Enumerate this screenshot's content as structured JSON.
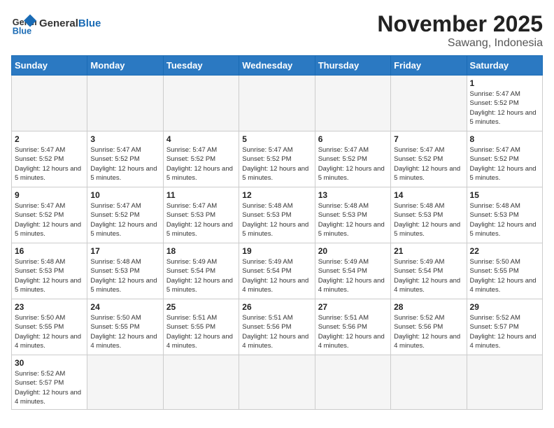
{
  "header": {
    "logo_general": "General",
    "logo_blue": "Blue",
    "month_title": "November 2025",
    "location": "Sawang, Indonesia"
  },
  "days_of_week": [
    "Sunday",
    "Monday",
    "Tuesday",
    "Wednesday",
    "Thursday",
    "Friday",
    "Saturday"
  ],
  "weeks": [
    [
      {
        "day": "",
        "info": ""
      },
      {
        "day": "",
        "info": ""
      },
      {
        "day": "",
        "info": ""
      },
      {
        "day": "",
        "info": ""
      },
      {
        "day": "",
        "info": ""
      },
      {
        "day": "",
        "info": ""
      },
      {
        "day": "1",
        "info": "Sunrise: 5:47 AM\nSunset: 5:52 PM\nDaylight: 12 hours\nand 5 minutes."
      }
    ],
    [
      {
        "day": "2",
        "info": "Sunrise: 5:47 AM\nSunset: 5:52 PM\nDaylight: 12 hours\nand 5 minutes."
      },
      {
        "day": "3",
        "info": "Sunrise: 5:47 AM\nSunset: 5:52 PM\nDaylight: 12 hours\nand 5 minutes."
      },
      {
        "day": "4",
        "info": "Sunrise: 5:47 AM\nSunset: 5:52 PM\nDaylight: 12 hours\nand 5 minutes."
      },
      {
        "day": "5",
        "info": "Sunrise: 5:47 AM\nSunset: 5:52 PM\nDaylight: 12 hours\nand 5 minutes."
      },
      {
        "day": "6",
        "info": "Sunrise: 5:47 AM\nSunset: 5:52 PM\nDaylight: 12 hours\nand 5 minutes."
      },
      {
        "day": "7",
        "info": "Sunrise: 5:47 AM\nSunset: 5:52 PM\nDaylight: 12 hours\nand 5 minutes."
      },
      {
        "day": "8",
        "info": "Sunrise: 5:47 AM\nSunset: 5:52 PM\nDaylight: 12 hours\nand 5 minutes."
      }
    ],
    [
      {
        "day": "9",
        "info": "Sunrise: 5:47 AM\nSunset: 5:52 PM\nDaylight: 12 hours\nand 5 minutes."
      },
      {
        "day": "10",
        "info": "Sunrise: 5:47 AM\nSunset: 5:52 PM\nDaylight: 12 hours\nand 5 minutes."
      },
      {
        "day": "11",
        "info": "Sunrise: 5:47 AM\nSunset: 5:53 PM\nDaylight: 12 hours\nand 5 minutes."
      },
      {
        "day": "12",
        "info": "Sunrise: 5:48 AM\nSunset: 5:53 PM\nDaylight: 12 hours\nand 5 minutes."
      },
      {
        "day": "13",
        "info": "Sunrise: 5:48 AM\nSunset: 5:53 PM\nDaylight: 12 hours\nand 5 minutes."
      },
      {
        "day": "14",
        "info": "Sunrise: 5:48 AM\nSunset: 5:53 PM\nDaylight: 12 hours\nand 5 minutes."
      },
      {
        "day": "15",
        "info": "Sunrise: 5:48 AM\nSunset: 5:53 PM\nDaylight: 12 hours\nand 5 minutes."
      }
    ],
    [
      {
        "day": "16",
        "info": "Sunrise: 5:48 AM\nSunset: 5:53 PM\nDaylight: 12 hours\nand 5 minutes."
      },
      {
        "day": "17",
        "info": "Sunrise: 5:48 AM\nSunset: 5:53 PM\nDaylight: 12 hours\nand 5 minutes."
      },
      {
        "day": "18",
        "info": "Sunrise: 5:49 AM\nSunset: 5:54 PM\nDaylight: 12 hours\nand 5 minutes."
      },
      {
        "day": "19",
        "info": "Sunrise: 5:49 AM\nSunset: 5:54 PM\nDaylight: 12 hours\nand 4 minutes."
      },
      {
        "day": "20",
        "info": "Sunrise: 5:49 AM\nSunset: 5:54 PM\nDaylight: 12 hours\nand 4 minutes."
      },
      {
        "day": "21",
        "info": "Sunrise: 5:49 AM\nSunset: 5:54 PM\nDaylight: 12 hours\nand 4 minutes."
      },
      {
        "day": "22",
        "info": "Sunrise: 5:50 AM\nSunset: 5:55 PM\nDaylight: 12 hours\nand 4 minutes."
      }
    ],
    [
      {
        "day": "23",
        "info": "Sunrise: 5:50 AM\nSunset: 5:55 PM\nDaylight: 12 hours\nand 4 minutes."
      },
      {
        "day": "24",
        "info": "Sunrise: 5:50 AM\nSunset: 5:55 PM\nDaylight: 12 hours\nand 4 minutes."
      },
      {
        "day": "25",
        "info": "Sunrise: 5:51 AM\nSunset: 5:55 PM\nDaylight: 12 hours\nand 4 minutes."
      },
      {
        "day": "26",
        "info": "Sunrise: 5:51 AM\nSunset: 5:56 PM\nDaylight: 12 hours\nand 4 minutes."
      },
      {
        "day": "27",
        "info": "Sunrise: 5:51 AM\nSunset: 5:56 PM\nDaylight: 12 hours\nand 4 minutes."
      },
      {
        "day": "28",
        "info": "Sunrise: 5:52 AM\nSunset: 5:56 PM\nDaylight: 12 hours\nand 4 minutes."
      },
      {
        "day": "29",
        "info": "Sunrise: 5:52 AM\nSunset: 5:57 PM\nDaylight: 12 hours\nand 4 minutes."
      }
    ],
    [
      {
        "day": "30",
        "info": "Sunrise: 5:52 AM\nSunset: 5:57 PM\nDaylight: 12 hours\nand 4 minutes."
      },
      {
        "day": "",
        "info": ""
      },
      {
        "day": "",
        "info": ""
      },
      {
        "day": "",
        "info": ""
      },
      {
        "day": "",
        "info": ""
      },
      {
        "day": "",
        "info": ""
      },
      {
        "day": "",
        "info": ""
      }
    ]
  ]
}
